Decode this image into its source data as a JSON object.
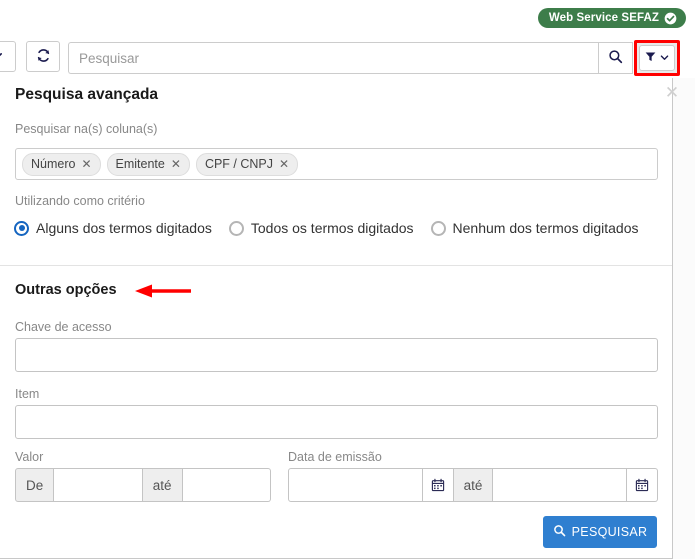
{
  "topbar": {
    "badge_label": "Web Service SEFAZ",
    "badge_icon": "check-circle-icon",
    "badge_color": "#3d7d4a"
  },
  "toolbar": {
    "dropdown_icon": "chevron-down-icon",
    "refresh_icon": "refresh-icon",
    "search_placeholder": "Pesquisar",
    "search_value": "",
    "search_icon": "search-icon",
    "filter_icon": "filter-icon",
    "filter_caret_icon": "chevron-down-icon",
    "filter_highlight_color": "#ff0000"
  },
  "panel": {
    "title": "Pesquisa avançada",
    "close_icon": "close-icon",
    "columns_label": "Pesquisar na(s) coluna(s)",
    "column_tags": [
      {
        "label": "Número",
        "remove_icon": "close-icon"
      },
      {
        "label": "Emitente",
        "remove_icon": "close-icon"
      },
      {
        "label": "CPF / CNPJ",
        "remove_icon": "close-icon"
      }
    ],
    "criteria_label": "Utilizando como critério",
    "criteria_options": [
      {
        "label": "Alguns dos termos digitados",
        "selected": true
      },
      {
        "label": "Todos os termos digitados",
        "selected": false
      },
      {
        "label": "Nenhum dos termos digitados",
        "selected": false
      }
    ],
    "criteria_selected_color": "#1565c0"
  },
  "other_options": {
    "section_title": "Outras opções",
    "annotation_arrow_color": "#ff0000",
    "chave_label": "Chave de acesso",
    "chave_value": "",
    "item_label": "Item",
    "item_value": "",
    "valor_label": "Valor",
    "valor_from_addon": "De",
    "valor_from_value": "",
    "valor_to_addon": "até",
    "valor_to_value": "",
    "data_label": "Data de emissão",
    "data_from_value": "",
    "data_from_icon": "calendar-icon",
    "data_to_addon": "até",
    "data_to_value": "",
    "data_to_icon": "calendar-icon"
  },
  "footer": {
    "submit_label": "PESQUISAR",
    "submit_icon": "search-icon",
    "submit_color": "#2f7fd0"
  }
}
